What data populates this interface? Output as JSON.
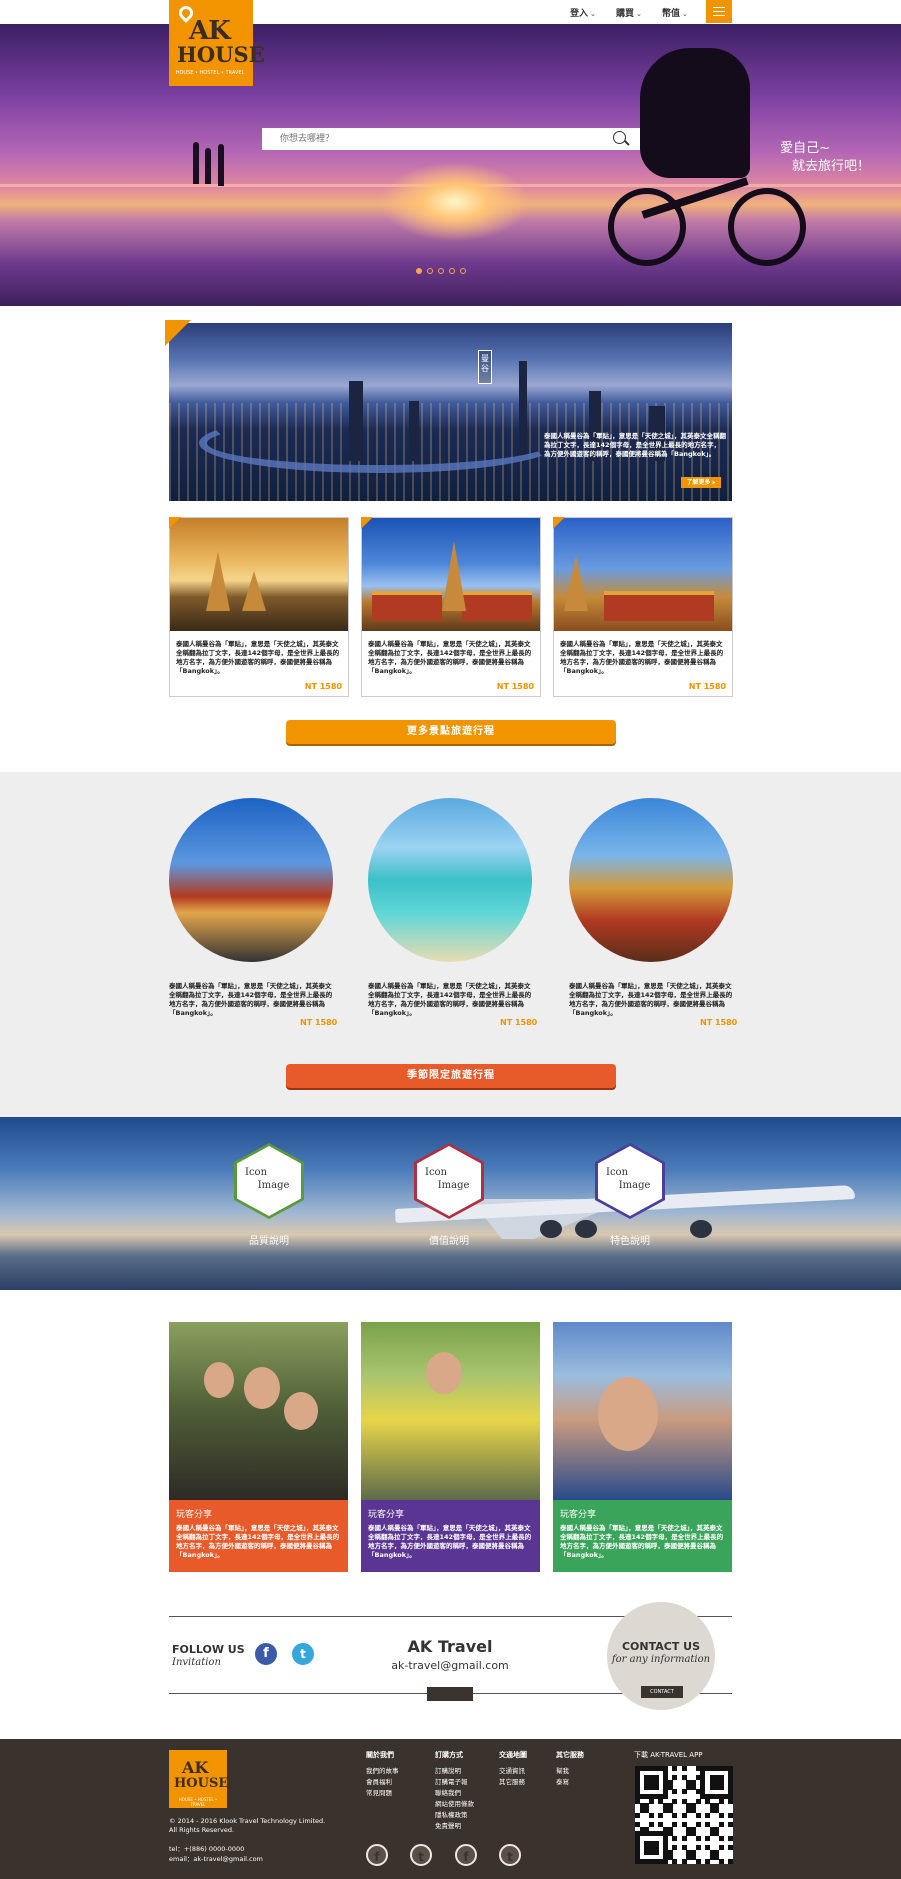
{
  "nav": {
    "items": [
      "登入",
      "購買",
      "幣值"
    ],
    "menu_icon": "hamburger-icon"
  },
  "logo": {
    "line1": "AK",
    "line2": "HOUSE",
    "sub": "HOUSE • HOSTEL • TRAVEL"
  },
  "hero": {
    "search_placeholder": "你想去哪裡？",
    "slogan_line1": "愛自己~",
    "slogan_line2": "就去旅行吧！",
    "slides": 5,
    "active_slide": 1
  },
  "feature": {
    "label": "曼谷",
    "desc": "泰國人稱曼谷為「軍貼」，意思是「天使之城」，其英泰文全稱翻為拉丁文字，長達142個字母，是全世界上最長的地方名字，為方便外國遊客的稱呼，泰國便將曼谷稱為「Bangkok」。",
    "more": "了解更多 ▸"
  },
  "tours": [
    {
      "desc": "泰國人稱曼谷為「軍貼」，意思是「天使之城」，其英泰文全稱翻為拉丁文字，長達142個字母，是全世界上最長的地方名字，為方便外國遊客的稱呼，泰國便將曼谷稱為「Bangkok」。",
      "price": "NT 1580"
    },
    {
      "desc": "泰國人稱曼谷為「軍貼」，意思是「天使之城」，其英泰文全稱翻為拉丁文字，長達142個字母，是全世界上最長的地方名字，為方便外國遊客的稱呼，泰國便將曼谷稱為「Bangkok」。",
      "price": "NT 1580"
    },
    {
      "desc": "泰國人稱曼谷為「軍貼」，意思是「天使之城」，其英泰文全稱翻為拉丁文字，長達142個字母，是全世界上最長的地方名字，為方便外國遊客的稱呼，泰國便將曼谷稱為「Bangkok」。",
      "price": "NT 1580"
    }
  ],
  "more_tours_button": "更多景點旅遊行程",
  "seasonal": [
    {
      "desc": "泰國人稱曼谷為「軍貼」，意思是「天使之城」，其英泰文全稱翻為拉丁文字，長達142個字母，是全世界上最長的地方名字，為方便外國遊客的稱呼，泰國便將曼谷稱為「Bangkok」。",
      "price": "NT 1580"
    },
    {
      "desc": "泰國人稱曼谷為「軍貼」，意思是「天使之城」，其英泰文全稱翻為拉丁文字，長達142個字母，是全世界上最長的地方名字，為方便外國遊客的稱呼，泰國便將曼谷稱為「Bangkok」。",
      "price": "NT 1580"
    },
    {
      "desc": "泰國人稱曼谷為「軍貼」，意思是「天使之城」，其英泰文全稱翻為拉丁文字，長達142個字母，是全世界上最長的地方名字，為方便外國遊客的稱呼，泰國便將曼谷稱為「Bangkok」。",
      "price": "NT 1580"
    }
  ],
  "seasonal_button": "季節限定旅遊行程",
  "features": [
    {
      "icon_l1": "Icon",
      "icon_l2": "Image",
      "caption": "品質說明",
      "color": "#5a9a3a"
    },
    {
      "icon_l1": "Icon",
      "icon_l2": "Image",
      "caption": "價值說明",
      "color": "#b03040"
    },
    {
      "icon_l1": "Icon",
      "icon_l2": "Image",
      "caption": "特色說明",
      "color": "#4a3f9a"
    }
  ],
  "shares": [
    {
      "title": "玩客分享",
      "desc": "泰國人稱曼谷為「軍貼」，意思是「天使之城」，其英泰文全稱翻為拉丁文字，長達142個字母，是全世界上最長的地方名字，為方便外國遊客的稱呼，泰國便將曼谷稱為「Bangkok」。",
      "color": "#e85a2a"
    },
    {
      "title": "玩客分享",
      "desc": "泰國人稱曼谷為「軍貼」，意思是「天使之城」，其英泰文全稱翻為拉丁文字，長達142個字母，是全世界上最長的地方名字，為方便外國遊客的稱呼，泰國便將曼谷稱為「Bangkok」。",
      "color": "#5a3593"
    },
    {
      "title": "玩客分享",
      "desc": "泰國人稱曼谷為「軍貼」，意思是「天使之城」，其英泰文全稱翻為拉丁文字，長達142個字母，是全世界上最長的地方名字，為方便外國遊客的稱呼，泰國便將曼谷稱為「Bangkok」。",
      "color": "#3aa55a"
    }
  ],
  "contact": {
    "follow": "FOLLOW US",
    "invitation": "Invitation",
    "fb": "f",
    "tw": "t",
    "brand": "AK Travel",
    "email": "ak-travel@gmail.com",
    "title": "CONTACT US",
    "subtitle": "for any information",
    "button": "CONTACT"
  },
  "footer": {
    "copyright": "© 2014 - 2016 Klook Travel Technology Limited. All Rights Reserved.",
    "tel": "tel：+(886) 0000-0000",
    "email": "email：ak-travel@gmail.com",
    "columns": [
      {
        "title": "關於我們",
        "links": [
          "我們的故事",
          "會員福利",
          "常見問題"
        ]
      },
      {
        "title": "訂購方式",
        "links": [
          "訂購說明",
          "訂購電子報",
          "聯絡我們",
          "網站使用條款",
          "隱私權政策",
          "免責聲明"
        ]
      },
      {
        "title": "交通地圖",
        "links": [
          "交通資訊",
          "其它服務"
        ]
      },
      {
        "title": "其它服務",
        "links": [
          "幫我",
          "泰寫"
        ]
      }
    ],
    "social": [
      "f",
      "t",
      "f",
      "t"
    ],
    "app_title": "下載 AK-TRAVEL APP"
  }
}
